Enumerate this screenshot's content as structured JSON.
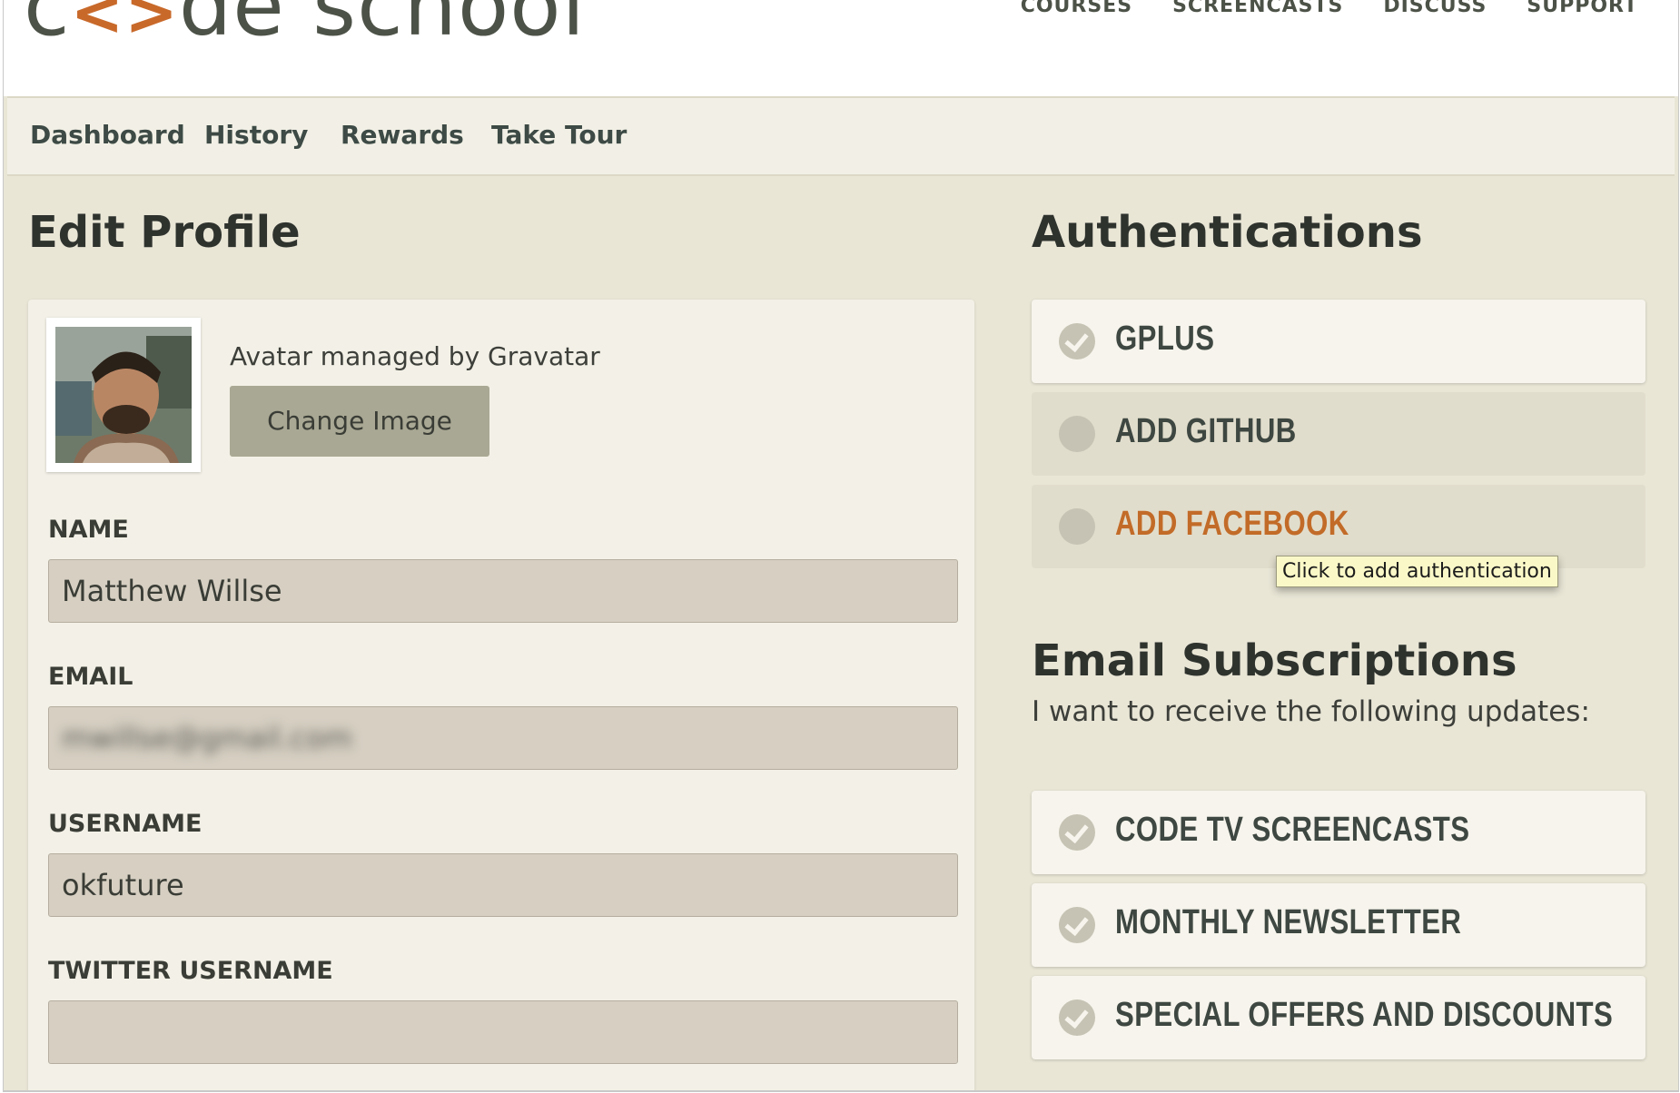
{
  "header": {
    "logo_text_a": "c",
    "logo_brackets": "<>",
    "logo_text_b": "de school",
    "nav": [
      "COURSES",
      "SCREENCASTS",
      "DISCUSS",
      "SUPPORT"
    ]
  },
  "subnav": {
    "items": [
      "Dashboard",
      "History",
      "Rewards",
      "Take Tour"
    ]
  },
  "profile": {
    "title": "Edit Profile",
    "avatar_note": "Avatar managed by Gravatar",
    "change_image_label": "Change Image",
    "fields": {
      "name": {
        "label": "NAME",
        "value": "Matthew Willse"
      },
      "email": {
        "label": "EMAIL",
        "value": "mwillse@gmail.com"
      },
      "username": {
        "label": "USERNAME",
        "value": "okfuture"
      },
      "twitter": {
        "label": "TWITTER USERNAME",
        "value": ""
      }
    }
  },
  "authentications": {
    "title": "Authentications",
    "items": [
      {
        "label": "GPLUS",
        "state": "connected"
      },
      {
        "label": "ADD GITHUB",
        "state": "not-connected"
      },
      {
        "label": "ADD FACEBOOK",
        "state": "not-connected-hover"
      }
    ],
    "tooltip": "Click to add authentication"
  },
  "subscriptions": {
    "title": "Email Subscriptions",
    "intro": "I want to receive the following updates:",
    "items": [
      {
        "label": "CODE TV SCREENCASTS",
        "checked": true
      },
      {
        "label": "MONTHLY NEWSLETTER",
        "checked": true
      },
      {
        "label": "SPECIAL OFFERS AND DISCOUNTS",
        "checked": true
      }
    ]
  },
  "colors": {
    "accent": "#c26b28",
    "page_bg": "#e9e6d6",
    "input_bg": "#d6cfc2",
    "button_bg": "#a9a894"
  }
}
